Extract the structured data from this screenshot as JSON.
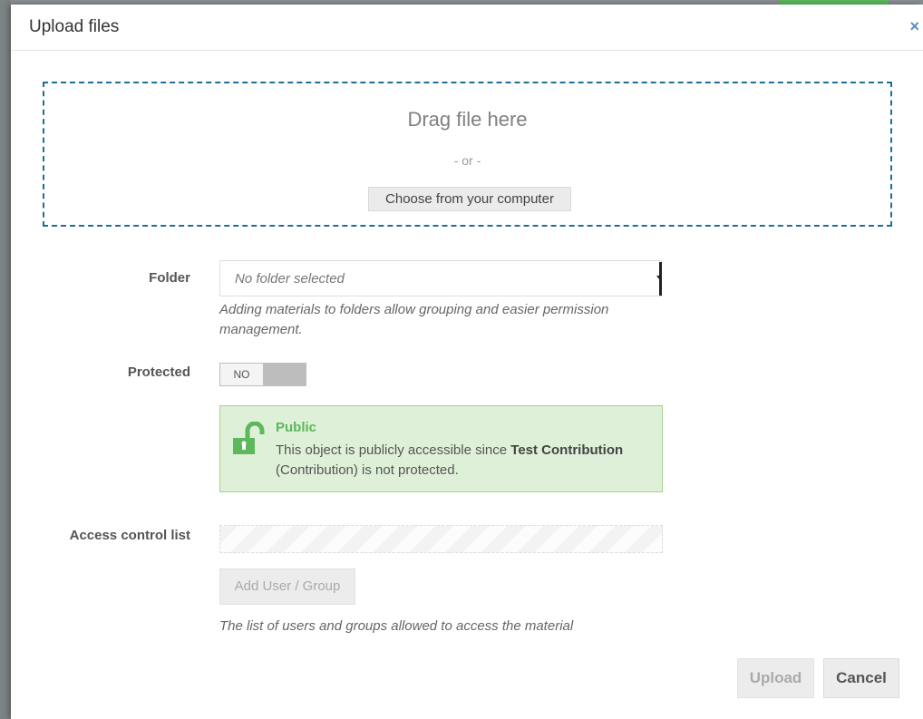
{
  "dialog": {
    "title": "Upload files",
    "close_icon": "×"
  },
  "dropzone": {
    "title": "Drag file here",
    "or_text": "- or -",
    "choose_button": "Choose from your computer"
  },
  "folder": {
    "label": "Folder",
    "value": "No folder selected",
    "help": "Adding materials to folders allow grouping and easier permission management."
  },
  "protected": {
    "label": "Protected",
    "toggle_state": "NO"
  },
  "alert": {
    "icon": "unlock-icon",
    "title": "Public",
    "body_prefix": "This object is publicly accessible since ",
    "body_bold": "Test Contribution",
    "body_suffix": " (Contribution) is not protected.",
    "color": "#5cb85c"
  },
  "acl": {
    "label": "Access control list",
    "add_button": "Add User / Group",
    "help": "The list of users and groups allowed to access the material"
  },
  "footer": {
    "upload_button": "Upload",
    "cancel_button": "Cancel"
  }
}
